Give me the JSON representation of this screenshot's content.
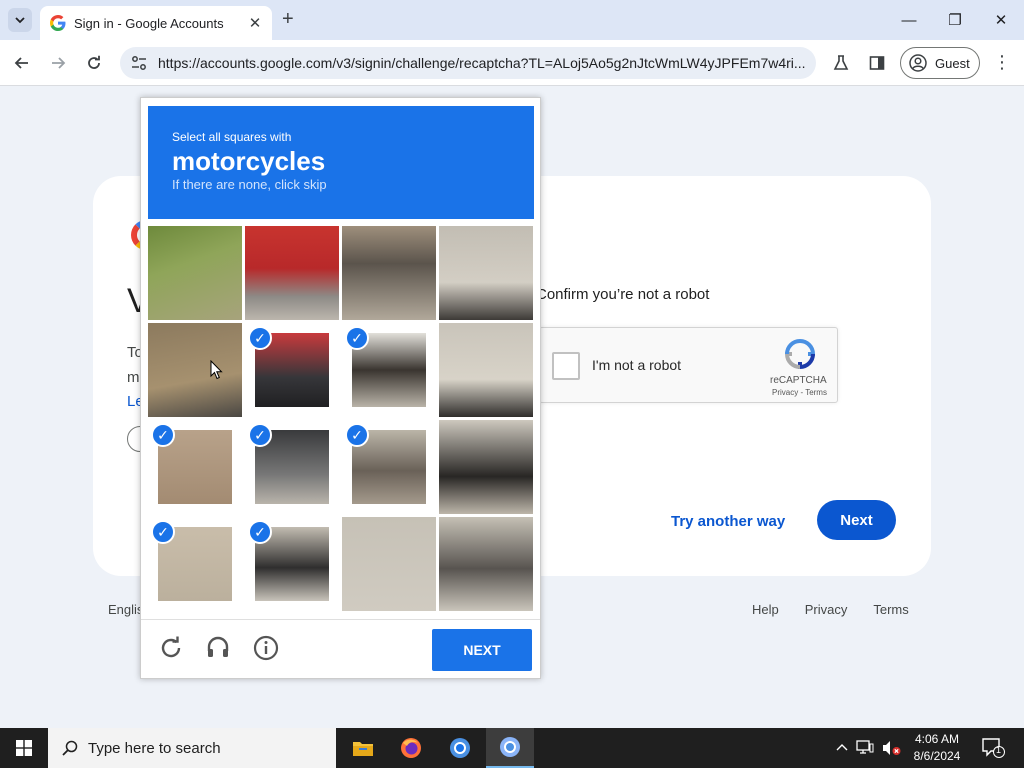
{
  "browser": {
    "tab": {
      "title": "Sign in - Google Accounts",
      "close": "✕"
    },
    "new_tab": "+",
    "window_controls": {
      "minimize": "—",
      "restore": "❐",
      "close": "✕"
    },
    "url": "https://accounts.google.com/v3/signin/challenge/recaptcha?TL=ALoj5Ao5g2nJtcWmLW4yJPFEm7w4ri...",
    "profile_label": "Guest",
    "menu": "⋮"
  },
  "signin": {
    "heading_fragment": "V",
    "desc_fragment_1": "To",
    "desc_fragment_2": "m",
    "link_fragment": "Le",
    "confirm_text": "Confirm you’re not a robot",
    "recaptcha": {
      "checkbox_label": "I'm not a robot",
      "brand": "reCAPTCHA",
      "terms": "Privacy - Terms"
    },
    "try_another_way": "Try another way",
    "next": "Next",
    "footer": {
      "language": "Englis",
      "links": [
        "Help",
        "Privacy",
        "Terms"
      ]
    }
  },
  "challenge": {
    "prompt": "Select all squares with",
    "object": "motorcycles",
    "hint": "If there are none, click skip",
    "grid_size": 4,
    "tiles": [
      {
        "selected": false
      },
      {
        "selected": false
      },
      {
        "selected": false
      },
      {
        "selected": false
      },
      {
        "selected": false
      },
      {
        "selected": true
      },
      {
        "selected": true
      },
      {
        "selected": false
      },
      {
        "selected": true
      },
      {
        "selected": true
      },
      {
        "selected": true
      },
      {
        "selected": false
      },
      {
        "selected": true
      },
      {
        "selected": true
      },
      {
        "selected": false
      },
      {
        "selected": false
      }
    ],
    "next_label": "NEXT",
    "icons": [
      "reload-icon",
      "audio-challenge-icon",
      "info-icon"
    ]
  },
  "taskbar": {
    "search_placeholder": "Type here to search",
    "time": "4:06 AM",
    "date": "8/6/2024",
    "notification_count": "1"
  },
  "colors": {
    "challenge_blue": "#1a73e8",
    "google_blue": "#0b57d0",
    "taskbar": "#1f1f1f"
  }
}
